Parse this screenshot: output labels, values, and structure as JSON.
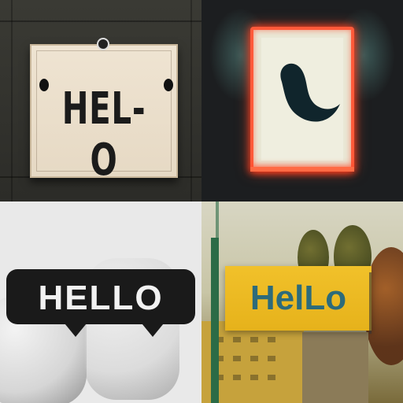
{
  "tiles": [
    {
      "label": "HEL-O"
    },
    {
      "label": ""
    },
    {
      "label": "HELLO"
    },
    {
      "label": "HelLo"
    }
  ],
  "colors": {
    "tile1_bg": "#2c2c28",
    "tile2_neon": "#ff5a3a",
    "tile3_bubble": "#1a1a1a",
    "tile4_board": "#f1c12a",
    "tile4_text": "#2d6b7a"
  }
}
